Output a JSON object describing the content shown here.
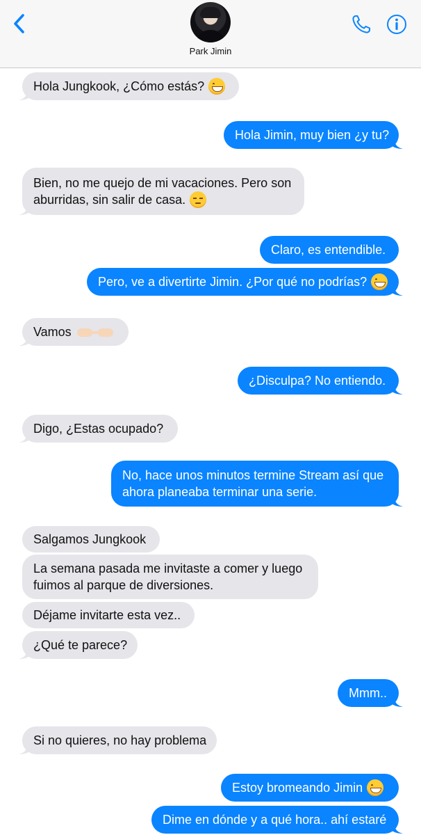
{
  "header": {
    "back_icon": "chevron-left-icon",
    "contact_name": "Park Jimin",
    "phone_icon": "phone-icon",
    "info_icon": "info-icon",
    "accent_color": "#0a84ff"
  },
  "messages": [
    {
      "from": "received",
      "lines": [
        "Hola Jungkook, ¿Cómo estás?"
      ],
      "emoji": "grinning-face"
    },
    {
      "from": "sent",
      "lines": [
        "Hola Jimin, muy bien ¿y tu?"
      ]
    },
    {
      "from": "received",
      "lines": [
        "Bien, no me quejo de mi vacaciones. Pero son",
        "aburridas, sin salir de casa."
      ],
      "emoji": "pensive-face"
    },
    {
      "from": "sent",
      "lines": [
        "Claro, es entendible."
      ]
    },
    {
      "from": "sent",
      "lines": [
        "Pero, ve a divertirte Jimin. ¿Por qué no podrías?"
      ],
      "emoji": "grinning-face"
    },
    {
      "from": "received",
      "lines": [
        "Vamos"
      ],
      "emoji": "pointing-fingers"
    },
    {
      "from": "sent",
      "lines": [
        "¿Disculpa? No entiendo."
      ]
    },
    {
      "from": "received",
      "lines": [
        "Digo, ¿Estas ocupado?"
      ]
    },
    {
      "from": "sent",
      "lines": [
        "No, hace unos minutos termine Stream así que",
        "ahora planeaba terminar una serie."
      ]
    },
    {
      "from": "received",
      "lines": [
        "Salgamos Jungkook"
      ]
    },
    {
      "from": "received",
      "lines": [
        "La semana pasada me invitaste a comer y luego",
        "fuimos al parque de diversiones."
      ]
    },
    {
      "from": "received",
      "lines": [
        "Déjame invitarte esta vez.."
      ]
    },
    {
      "from": "received",
      "lines": [
        "¿Qué te parece?"
      ]
    },
    {
      "from": "sent",
      "lines": [
        "Mmm.."
      ]
    },
    {
      "from": "received",
      "lines": [
        "Si no quieres, no hay problema"
      ]
    },
    {
      "from": "sent",
      "lines": [
        "Estoy bromeando Jimin"
      ],
      "emoji": "grinning-face"
    },
    {
      "from": "sent",
      "lines": [
        "Dime en dónde y a qué hora.. ahí estaré"
      ]
    }
  ]
}
